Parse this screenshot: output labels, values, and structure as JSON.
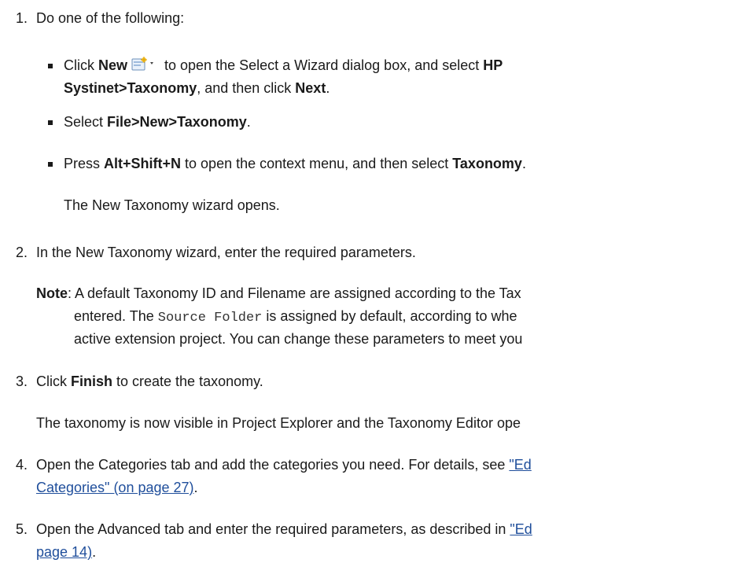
{
  "steps": [
    {
      "number": "1.",
      "intro": "Do one of the following:",
      "bullets": [
        {
          "line1": {
            "t1": "Click ",
            "b1": "New",
            "t2": " to open the Select a Wizard dialog box, and select ",
            "b2": "HP"
          },
          "line2": {
            "b1": "Systinet>Taxonomy",
            "t1": ", and then click ",
            "b2": "Next",
            "t2": "."
          }
        },
        {
          "t1": "Select ",
          "b1": "File>New>Taxonomy",
          "t2": "."
        },
        {
          "t1": "Press ",
          "b1": "Alt+Shift+N",
          "t2": " to open the context menu, and then select ",
          "b2": "Taxonomy",
          "t3": "."
        }
      ],
      "result": "The New Taxonomy wizard opens."
    },
    {
      "number": "2.",
      "text": "In the New Taxonomy wizard, enter the required parameters.",
      "note": {
        "label": "Note",
        "line1": ": A default Taxonomy ID and Filename are assigned according to the Tax",
        "line2_pre": "entered. The ",
        "line2_code": "Source Folder",
        "line2_post": " is assigned by default, according to whe",
        "line3": "active extension project. You can change these parameters to meet you"
      }
    },
    {
      "number": "3.",
      "t1": "Click ",
      "b1": "Finish",
      "t2": " to create the taxonomy.",
      "result": "The taxonomy is now visible in Project Explorer and the Taxonomy Editor ope"
    },
    {
      "number": "4.",
      "text": "Open the Categories tab and add the categories you need. For details, see ",
      "link_line1": "\"Ed",
      "link_line2": "Categories\" (on page 27)",
      "end": "."
    },
    {
      "number": "5.",
      "text": "Open the Advanced tab and enter the required parameters, as described in ",
      "link_line1": "\"Ed",
      "link_line2": "page 14)",
      "end": "."
    }
  ],
  "icons": {
    "new_icon": "new-wizard-icon"
  },
  "colors": {
    "link": "#1f4e9b",
    "text": "#1a1a1a"
  }
}
